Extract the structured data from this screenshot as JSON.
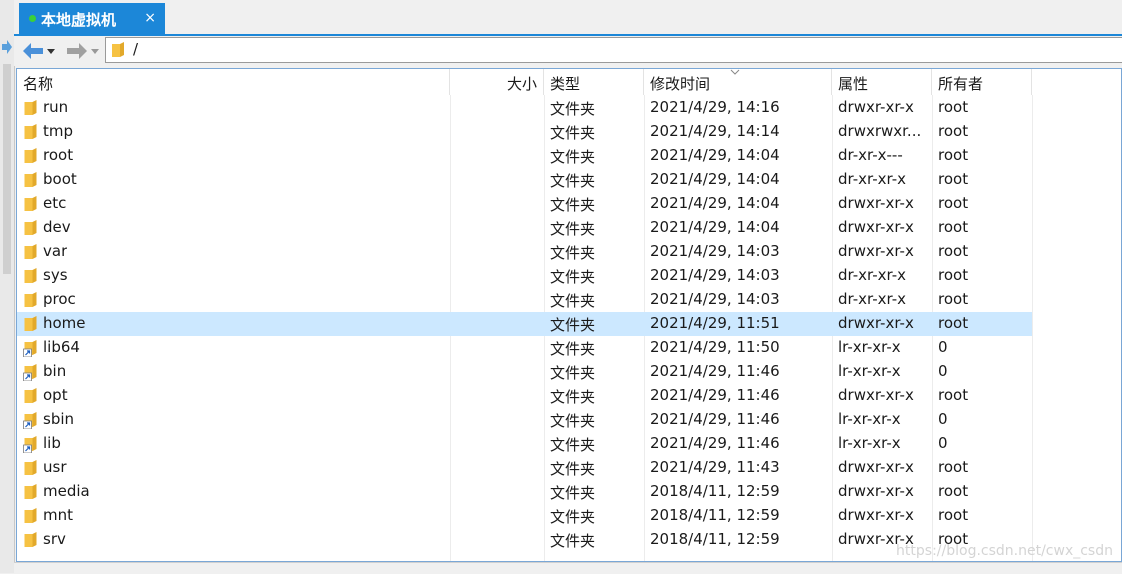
{
  "tab": {
    "title": "本地虚拟机",
    "close": "×"
  },
  "toolbar": {
    "path": "/"
  },
  "columns": {
    "name": "名称",
    "size": "大小",
    "type": "类型",
    "modified": "修改时间",
    "attributes": "属性",
    "owner": "所有者"
  },
  "rows": [
    {
      "name": "run",
      "type": "文件夹",
      "modified": "2021/4/29, 14:16",
      "attributes": "drwxr-xr-x",
      "owner": "root",
      "icon": "folder-icon"
    },
    {
      "name": "tmp",
      "type": "文件夹",
      "modified": "2021/4/29, 14:14",
      "attributes": "drwxrwxr...",
      "owner": "root",
      "icon": "folder-icon"
    },
    {
      "name": "root",
      "type": "文件夹",
      "modified": "2021/4/29, 14:04",
      "attributes": "dr-xr-x---",
      "owner": "root",
      "icon": "folder-icon"
    },
    {
      "name": "boot",
      "type": "文件夹",
      "modified": "2021/4/29, 14:04",
      "attributes": "dr-xr-xr-x",
      "owner": "root",
      "icon": "folder-icon"
    },
    {
      "name": "etc",
      "type": "文件夹",
      "modified": "2021/4/29, 14:04",
      "attributes": "drwxr-xr-x",
      "owner": "root",
      "icon": "folder-icon"
    },
    {
      "name": "dev",
      "type": "文件夹",
      "modified": "2021/4/29, 14:04",
      "attributes": "drwxr-xr-x",
      "owner": "root",
      "icon": "folder-icon"
    },
    {
      "name": "var",
      "type": "文件夹",
      "modified": "2021/4/29, 14:03",
      "attributes": "drwxr-xr-x",
      "owner": "root",
      "icon": "folder-icon"
    },
    {
      "name": "sys",
      "type": "文件夹",
      "modified": "2021/4/29, 14:03",
      "attributes": "dr-xr-xr-x",
      "owner": "root",
      "icon": "folder-icon"
    },
    {
      "name": "proc",
      "type": "文件夹",
      "modified": "2021/4/29, 14:03",
      "attributes": "dr-xr-xr-x",
      "owner": "root",
      "icon": "folder-icon"
    },
    {
      "name": "home",
      "type": "文件夹",
      "modified": "2021/4/29, 11:51",
      "attributes": "drwxr-xr-x",
      "owner": "root",
      "icon": "folder-icon",
      "selected": true
    },
    {
      "name": "lib64",
      "type": "文件夹",
      "modified": "2021/4/29, 11:50",
      "attributes": "lr-xr-xr-x",
      "owner": "0",
      "icon": "folder-link-icon"
    },
    {
      "name": "bin",
      "type": "文件夹",
      "modified": "2021/4/29, 11:46",
      "attributes": "lr-xr-xr-x",
      "owner": "0",
      "icon": "folder-link-icon"
    },
    {
      "name": "opt",
      "type": "文件夹",
      "modified": "2021/4/29, 11:46",
      "attributes": "drwxr-xr-x",
      "owner": "root",
      "icon": "folder-icon"
    },
    {
      "name": "sbin",
      "type": "文件夹",
      "modified": "2021/4/29, 11:46",
      "attributes": "lr-xr-xr-x",
      "owner": "0",
      "icon": "folder-link-icon"
    },
    {
      "name": "lib",
      "type": "文件夹",
      "modified": "2021/4/29, 11:46",
      "attributes": "lr-xr-xr-x",
      "owner": "0",
      "icon": "folder-link-icon"
    },
    {
      "name": "usr",
      "type": "文件夹",
      "modified": "2021/4/29, 11:43",
      "attributes": "drwxr-xr-x",
      "owner": "root",
      "icon": "folder-icon"
    },
    {
      "name": "media",
      "type": "文件夹",
      "modified": "2018/4/11, 12:59",
      "attributes": "drwxr-xr-x",
      "owner": "root",
      "icon": "folder-icon"
    },
    {
      "name": "mnt",
      "type": "文件夹",
      "modified": "2018/4/11, 12:59",
      "attributes": "drwxr-xr-x",
      "owner": "root",
      "icon": "folder-icon"
    },
    {
      "name": "srv",
      "type": "文件夹",
      "modified": "2018/4/11, 12:59",
      "attributes": "drwxr-xr-x",
      "owner": "root",
      "icon": "folder-icon"
    }
  ],
  "watermark": "https://blog.csdn.net/cwx_csdn",
  "colors": {
    "accent": "#1c87d8",
    "selection": "#cce8ff",
    "folder": "#f6c243",
    "status_dot": "#3ad03a"
  }
}
